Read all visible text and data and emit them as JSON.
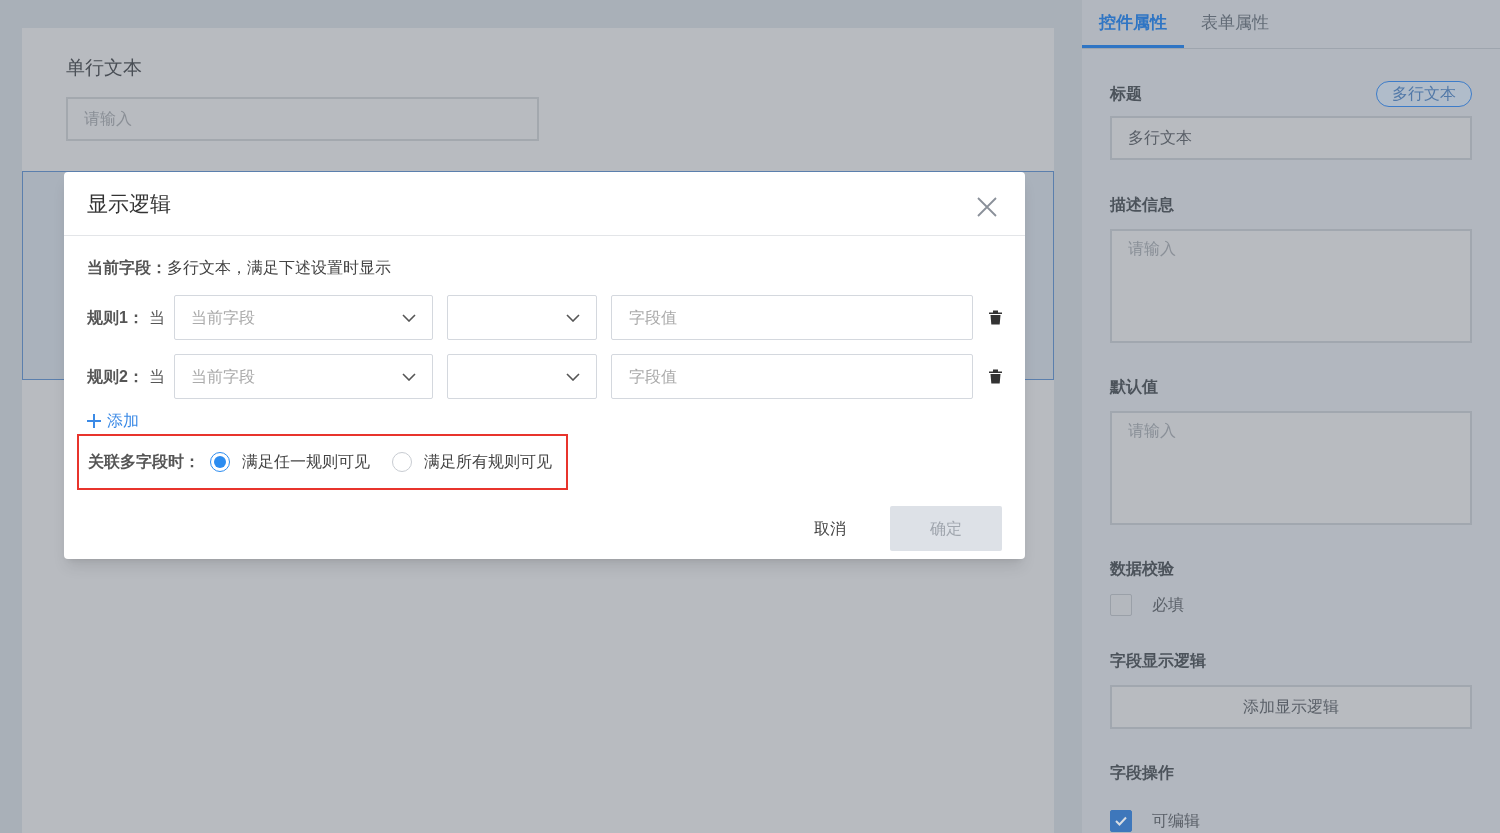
{
  "canvas": {
    "fields": [
      {
        "label": "单行文本",
        "placeholder": "请输入"
      }
    ]
  },
  "dialog": {
    "title": "显示逻辑",
    "current": {
      "label": "当前字段：",
      "text": "多行文本，满足下述设置时显示"
    },
    "rules": [
      {
        "label": "规则1：",
        "prefix": "当",
        "field_placeholder": "当前字段",
        "value_placeholder": "字段值"
      },
      {
        "label": "规则2：",
        "prefix": "当",
        "field_placeholder": "当前字段",
        "value_placeholder": "字段值"
      }
    ],
    "add": "添加",
    "match": {
      "label": "关联多字段时：",
      "highlighted": true,
      "options": [
        {
          "label": "满足任一规则可见",
          "selected": true
        },
        {
          "label": "满足所有规则可见",
          "selected": false
        }
      ]
    },
    "cancel": "取消",
    "confirm": {
      "label": "确定",
      "disabled": true
    }
  },
  "panel": {
    "tabs": [
      {
        "label": "控件属性",
        "selected": true
      },
      {
        "label": "表单属性",
        "selected": false
      }
    ],
    "title": {
      "label": "标题",
      "tag": "多行文本",
      "value": "多行文本"
    },
    "description": {
      "label": "描述信息",
      "placeholder": "请输入"
    },
    "default": {
      "label": "默认值",
      "placeholder": "请输入"
    },
    "validation": {
      "label": "数据校验",
      "checkbox": {
        "label": "必填",
        "checked": false
      }
    },
    "logic": {
      "label": "字段显示逻辑",
      "button": "添加显示逻辑"
    },
    "operations": {
      "label": "字段操作",
      "checkbox": {
        "label": "可编辑",
        "checked": true
      }
    }
  }
}
